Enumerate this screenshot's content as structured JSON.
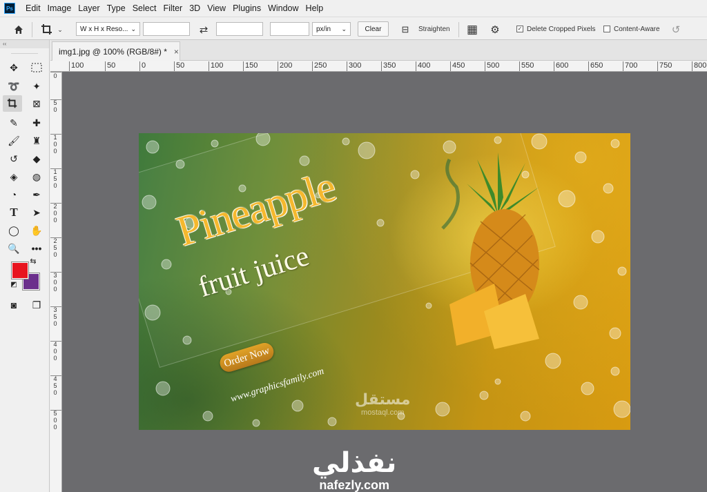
{
  "app": {
    "logo": "Ps"
  },
  "menu": [
    "Edit",
    "Image",
    "Layer",
    "Type",
    "Select",
    "Filter",
    "3D",
    "View",
    "Plugins",
    "Window",
    "Help"
  ],
  "options": {
    "ratio_preset": "W x H x Reso...",
    "width_value": "",
    "height_value": "",
    "resolution_value": "",
    "resolution_unit": "px/in",
    "clear_label": "Clear",
    "straighten_label": "Straighten",
    "delete_cropped_label": "Delete Cropped Pixels",
    "delete_cropped_checked": true,
    "content_aware_label": "Content-Aware",
    "content_aware_checked": false
  },
  "toolbar": {
    "collapse_label": "‹‹",
    "foreground_color": "#e8141f",
    "background_color": "#6b2f8c"
  },
  "document": {
    "tab_title": "img1.jpg @ 100% (RGB/8#) *",
    "close": "×"
  },
  "rulers": {
    "horizontal": [
      "100",
      "50",
      "0",
      "50",
      "100",
      "150",
      "200",
      "250",
      "300",
      "350",
      "400",
      "450",
      "500",
      "550",
      "600",
      "650",
      "700",
      "750",
      "800"
    ],
    "vertical": [
      "0",
      "5",
      "0",
      "1",
      "0",
      "0",
      "1",
      "5",
      "0",
      "2",
      "0",
      "0",
      "2",
      "5",
      "0",
      "3",
      "0",
      "0",
      "3",
      "5",
      "0",
      "4",
      "0",
      "0",
      "4",
      "5",
      "0",
      "5",
      "0",
      "0"
    ]
  },
  "image": {
    "title": "Pineapple",
    "subtitle": "fruit juice",
    "button": "Order Now",
    "website": "www.graphicsfamily.com"
  },
  "watermarks": {
    "mostaql_ar": "مستقل",
    "mostaql_en": "mostaql.com",
    "nafezly_ar": "نفذلي",
    "nafezly_en": "nafezly.com"
  }
}
